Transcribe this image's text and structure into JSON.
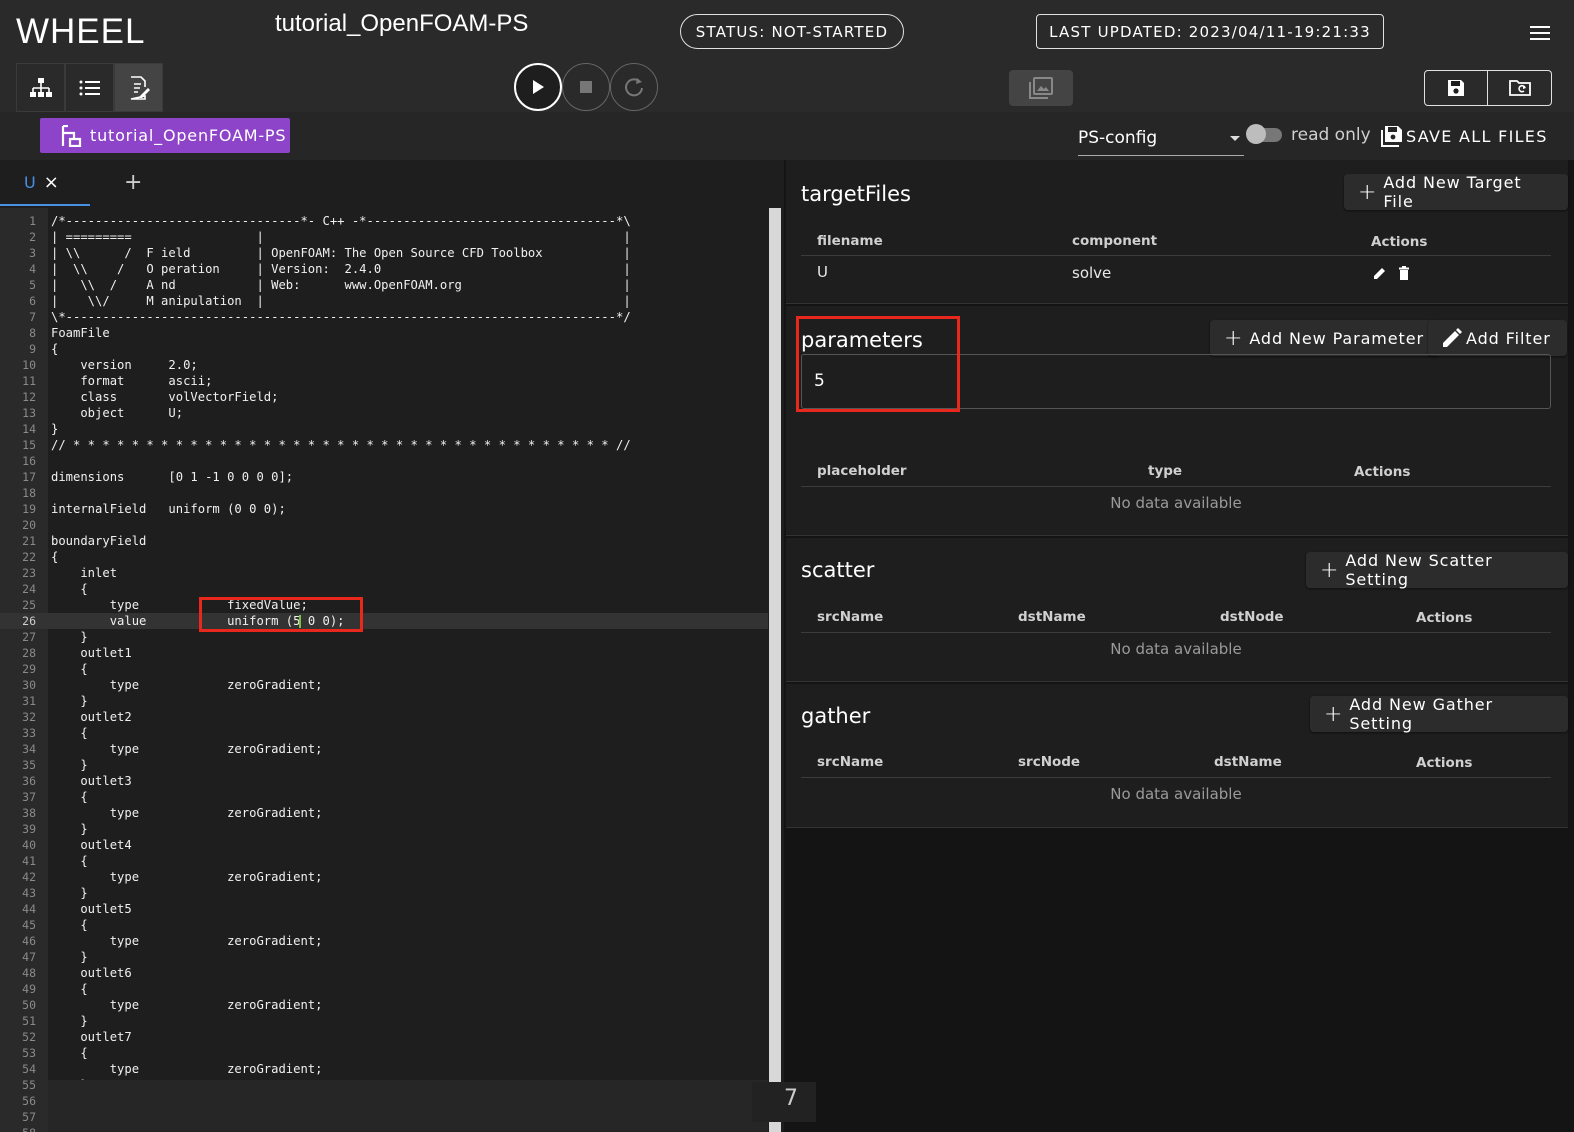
{
  "header": {
    "app_title": "WHEEL",
    "project_name": "tutorial_OpenFOAM-PS",
    "status": "STATUS: NOT-STARTED",
    "last_updated": "LAST UPDATED: 2023/04/11-19:21:33"
  },
  "subbar": {
    "component_name": "tutorial_OpenFOAM-PS",
    "ps_config": "PS-config",
    "read_only_label": "read only",
    "read_only": false,
    "save_all_label": "SAVE ALL FILES"
  },
  "editor": {
    "tab_name": "U",
    "close_glyph": "×",
    "add_glyph": "+",
    "active_line": 26,
    "lines": [
      "/*--------------------------------*- C++ -*----------------------------------*\\",
      "| =========                 |                                                 |",
      "| \\\\      /  F ield         | OpenFOAM: The Open Source CFD Toolbox           |",
      "|  \\\\    /   O peration     | Version:  2.4.0                                 |",
      "|   \\\\  /    A nd           | Web:      www.OpenFOAM.org                      |",
      "|    \\\\/     M anipulation  |                                                 |",
      "\\*---------------------------------------------------------------------------*/",
      "FoamFile",
      "{",
      "    version     2.0;",
      "    format      ascii;",
      "    class       volVectorField;",
      "    object      U;",
      "}",
      "// * * * * * * * * * * * * * * * * * * * * * * * * * * * * * * * * * * * * * //",
      "",
      "dimensions      [0 1 -1 0 0 0 0];",
      "",
      "internalField   uniform (0 0 0);",
      "",
      "boundaryField",
      "{",
      "    inlet",
      "    {",
      "        type            fixedValue;",
      "        value           uniform (5 0 0);",
      "    }",
      "    outlet1",
      "    {",
      "        type            zeroGradient;",
      "    }",
      "    outlet2",
      "    {",
      "        type            zeroGradient;",
      "    }",
      "    outlet3",
      "    {",
      "        type            zeroGradient;",
      "    }",
      "    outlet4",
      "    {",
      "        type            zeroGradient;",
      "    }",
      "    outlet5",
      "    {",
      "        type            zeroGradient;",
      "    }",
      "    outlet6",
      "    {",
      "        type            zeroGradient;",
      "    }",
      "    outlet7",
      "    {",
      "        type            zeroGradient;",
      "    }",
      "",
      "",
      ""
    ]
  },
  "target_files": {
    "title": "targetFiles",
    "add_label": "Add New Target File",
    "columns": [
      "filename",
      "component",
      "Actions"
    ],
    "rows": [
      {
        "filename": "U",
        "component": "solve"
      }
    ]
  },
  "parameters": {
    "title": "parameters",
    "add_label": "Add New Parameter",
    "filter_label": "Add Filter",
    "value": "5",
    "columns": [
      "placeholder",
      "type",
      "Actions"
    ],
    "empty_text": "No data available"
  },
  "scatter": {
    "title": "scatter",
    "add_label": "Add New Scatter Setting",
    "columns": [
      "srcName",
      "dstName",
      "dstNode",
      "Actions"
    ],
    "empty_text": "No data available"
  },
  "gather": {
    "title": "gather",
    "add_label": "Add New Gather Setting",
    "columns": [
      "srcName",
      "srcNode",
      "dstName",
      "Actions"
    ],
    "empty_text": "No data available"
  },
  "float_tab_glyph": "7",
  "colors": {
    "accent_blue": "#4a90e2",
    "component_purple": "#8e44c9",
    "highlight_red": "#e8281c",
    "cursor_green": "#7ac143"
  }
}
